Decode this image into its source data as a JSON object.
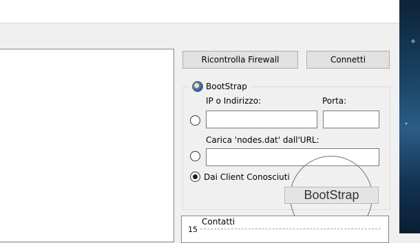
{
  "toolbar": {
    "recheck_firewall_label": "Ricontrolla Firewall",
    "connect_label": "Connetti"
  },
  "bootstrap_group": {
    "title": "BootStrap",
    "ip_label": "IP o Indirizzo:",
    "port_label": "Porta:",
    "ip_value": "",
    "port_value": "",
    "url_label": "Carica 'nodes.dat' dall'URL:",
    "url_value": "",
    "known_clients_label": "Dai Client Conosciuti",
    "selected_option": "known_clients",
    "bootstrap_button_label": "BootStrap"
  },
  "contacts_box": {
    "title": "Contatti",
    "count": "15"
  },
  "colors": {
    "window_bg": "#f0f0f0",
    "button_bg": "#e1e1e1",
    "button_border": "#adadad"
  }
}
